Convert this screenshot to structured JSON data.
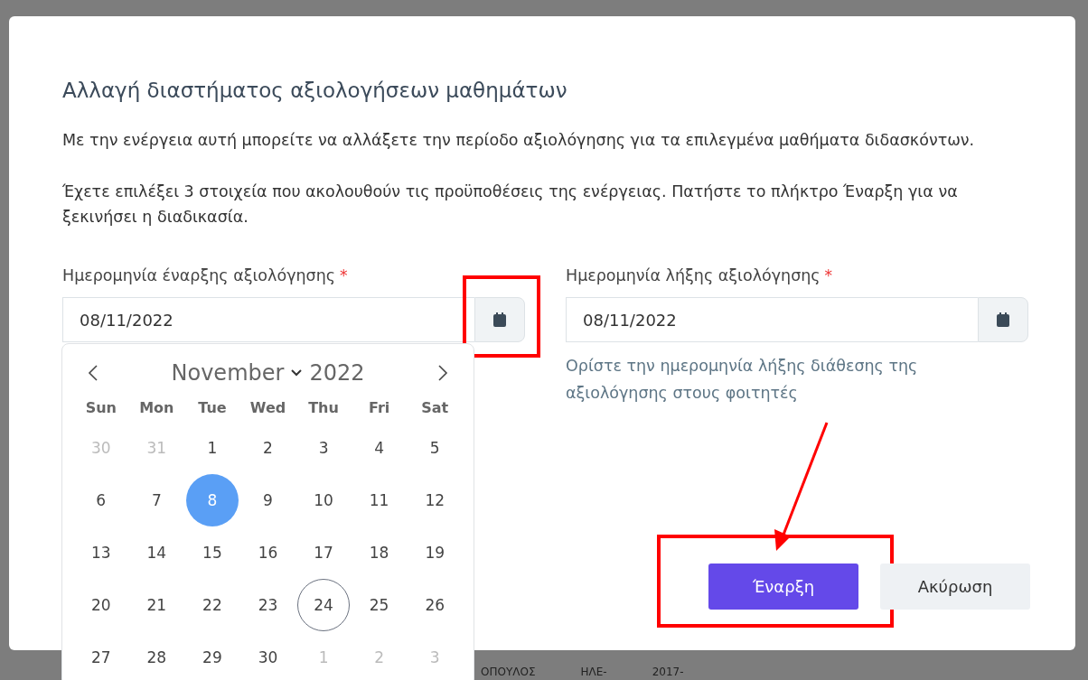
{
  "background_row": [
    "ΟΠΟΥΛΟΣ",
    "ΗΛΕ-",
    "2017-"
  ],
  "dialog": {
    "title": "Αλλαγή διαστήματος αξιολογήσεων μαθημάτων",
    "paragraphs": [
      "Με την ενέργεια αυτή μπορείτε να αλλάξετε την περίοδο αξιολόγησης για τα επιλεγμένα μαθήματα διδασκόντων.",
      "Έχετε επιλέξει 3 στοιχεία που ακολουθούν τις προϋποθέσεις της ενέργειας. Πατήστε το πλήκτρο Έναρξη για να ξεκινήσει η διαδικασία."
    ],
    "fields": [
      {
        "label": "Ημερομηνία έναρξης αξιολόγησης",
        "required_mark": "*",
        "value": "08/11/2022",
        "highlighted": true
      },
      {
        "label": "Ημερομηνία λήξης αξιολόγησης",
        "required_mark": "*",
        "value": "08/11/2022",
        "highlighted": false,
        "help": "Ορίστε την ημερομηνία λήξης διάθεσης της αξιολόγησης στους φοιτητές"
      }
    ],
    "buttons": [
      {
        "label": "Έναρξη",
        "kind": "primary",
        "highlighted": true
      },
      {
        "label": "Ακύρωση",
        "kind": "secondary",
        "highlighted": false
      }
    ]
  },
  "calendar": {
    "month": "November",
    "year": "2022",
    "weekdays": [
      "Sun",
      "Mon",
      "Tue",
      "Wed",
      "Thu",
      "Fri",
      "Sat"
    ],
    "days": [
      {
        "label": "30",
        "outside": true,
        "selected": false,
        "today": false
      },
      {
        "label": "31",
        "outside": true,
        "selected": false,
        "today": false
      },
      {
        "label": "1",
        "outside": false,
        "selected": false,
        "today": false
      },
      {
        "label": "2",
        "outside": false,
        "selected": false,
        "today": false
      },
      {
        "label": "3",
        "outside": false,
        "selected": false,
        "today": false
      },
      {
        "label": "4",
        "outside": false,
        "selected": false,
        "today": false
      },
      {
        "label": "5",
        "outside": false,
        "selected": false,
        "today": false
      },
      {
        "label": "6",
        "outside": false,
        "selected": false,
        "today": false
      },
      {
        "label": "7",
        "outside": false,
        "selected": false,
        "today": false
      },
      {
        "label": "8",
        "outside": false,
        "selected": true,
        "today": false
      },
      {
        "label": "9",
        "outside": false,
        "selected": false,
        "today": false
      },
      {
        "label": "10",
        "outside": false,
        "selected": false,
        "today": false
      },
      {
        "label": "11",
        "outside": false,
        "selected": false,
        "today": false
      },
      {
        "label": "12",
        "outside": false,
        "selected": false,
        "today": false
      },
      {
        "label": "13",
        "outside": false,
        "selected": false,
        "today": false
      },
      {
        "label": "14",
        "outside": false,
        "selected": false,
        "today": false
      },
      {
        "label": "15",
        "outside": false,
        "selected": false,
        "today": false
      },
      {
        "label": "16",
        "outside": false,
        "selected": false,
        "today": false
      },
      {
        "label": "17",
        "outside": false,
        "selected": false,
        "today": false
      },
      {
        "label": "18",
        "outside": false,
        "selected": false,
        "today": false
      },
      {
        "label": "19",
        "outside": false,
        "selected": false,
        "today": false
      },
      {
        "label": "20",
        "outside": false,
        "selected": false,
        "today": false
      },
      {
        "label": "21",
        "outside": false,
        "selected": false,
        "today": false
      },
      {
        "label": "22",
        "outside": false,
        "selected": false,
        "today": false
      },
      {
        "label": "23",
        "outside": false,
        "selected": false,
        "today": false
      },
      {
        "label": "24",
        "outside": false,
        "selected": false,
        "today": true
      },
      {
        "label": "25",
        "outside": false,
        "selected": false,
        "today": false
      },
      {
        "label": "26",
        "outside": false,
        "selected": false,
        "today": false
      },
      {
        "label": "27",
        "outside": false,
        "selected": false,
        "today": false
      },
      {
        "label": "28",
        "outside": false,
        "selected": false,
        "today": false
      },
      {
        "label": "29",
        "outside": false,
        "selected": false,
        "today": false
      },
      {
        "label": "30",
        "outside": false,
        "selected": false,
        "today": false
      },
      {
        "label": "1",
        "outside": true,
        "selected": false,
        "today": false
      },
      {
        "label": "2",
        "outside": true,
        "selected": false,
        "today": false
      },
      {
        "label": "3",
        "outside": true,
        "selected": false,
        "today": false
      }
    ]
  }
}
